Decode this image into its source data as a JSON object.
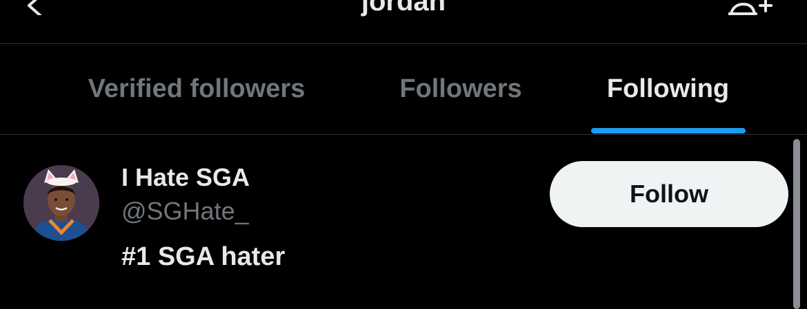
{
  "header": {
    "title": "jordan",
    "back_icon": "chevron-left-icon",
    "add_user_icon": "add-user-icon"
  },
  "tabs": [
    {
      "label": "Verified followers",
      "active": false
    },
    {
      "label": "Followers",
      "active": false
    },
    {
      "label": "Following",
      "active": true
    }
  ],
  "user": {
    "name": "I Hate SGA",
    "handle": "@SGHate_",
    "bio": "#1 SGA hater",
    "follow_label": "Follow"
  },
  "colors": {
    "background": "#000000",
    "accent": "#1d9bf0",
    "text_primary": "#e7e9ea",
    "text_secondary": "#71767b",
    "button_bg": "#eff3f4"
  }
}
